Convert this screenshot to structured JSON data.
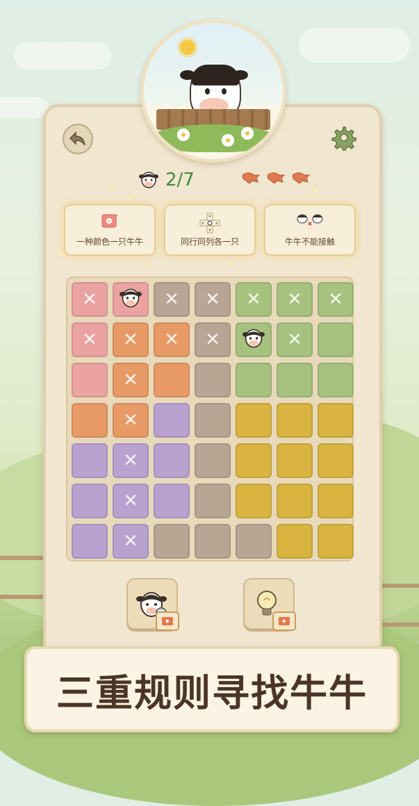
{
  "progress": {
    "found": 2,
    "total": 7,
    "text": "2/7"
  },
  "lives": 3,
  "rules": [
    {
      "label": "一种颜色一只牛牛",
      "icon": "flower-tile-icon"
    },
    {
      "label": "同行同列各一只",
      "icon": "row-column-icon"
    },
    {
      "label": "牛牛不能接触",
      "icon": "cows-no-touch-icon"
    }
  ],
  "board": {
    "colors": {
      "P": "#eaa3a0",
      "O": "#e89a66",
      "G": "#b8a594",
      "N": "#a6c27e",
      "V": "#b9a1d0",
      "Y": "#d9b440"
    },
    "rows": [
      [
        {
          "c": "P",
          "m": "x"
        },
        {
          "c": "P",
          "m": "cow"
        },
        {
          "c": "G",
          "m": "x"
        },
        {
          "c": "G",
          "m": "x"
        },
        {
          "c": "N",
          "m": "x"
        },
        {
          "c": "N",
          "m": "x"
        },
        {
          "c": "N",
          "m": "x"
        }
      ],
      [
        {
          "c": "P",
          "m": "x"
        },
        {
          "c": "O",
          "m": "x"
        },
        {
          "c": "O",
          "m": "x"
        },
        {
          "c": "G",
          "m": "x"
        },
        {
          "c": "N",
          "m": "cow"
        },
        {
          "c": "N",
          "m": "x"
        },
        {
          "c": "N",
          "m": ""
        }
      ],
      [
        {
          "c": "P",
          "m": ""
        },
        {
          "c": "O",
          "m": "x"
        },
        {
          "c": "O",
          "m": ""
        },
        {
          "c": "G",
          "m": ""
        },
        {
          "c": "N",
          "m": ""
        },
        {
          "c": "N",
          "m": ""
        },
        {
          "c": "N",
          "m": ""
        }
      ],
      [
        {
          "c": "O",
          "m": ""
        },
        {
          "c": "O",
          "m": "x"
        },
        {
          "c": "V",
          "m": ""
        },
        {
          "c": "G",
          "m": ""
        },
        {
          "c": "Y",
          "m": ""
        },
        {
          "c": "Y",
          "m": ""
        },
        {
          "c": "Y",
          "m": ""
        }
      ],
      [
        {
          "c": "V",
          "m": ""
        },
        {
          "c": "V",
          "m": "x"
        },
        {
          "c": "V",
          "m": ""
        },
        {
          "c": "G",
          "m": ""
        },
        {
          "c": "Y",
          "m": ""
        },
        {
          "c": "Y",
          "m": ""
        },
        {
          "c": "Y",
          "m": ""
        }
      ],
      [
        {
          "c": "V",
          "m": ""
        },
        {
          "c": "V",
          "m": "x"
        },
        {
          "c": "V",
          "m": ""
        },
        {
          "c": "G",
          "m": ""
        },
        {
          "c": "Y",
          "m": ""
        },
        {
          "c": "Y",
          "m": ""
        },
        {
          "c": "Y",
          "m": ""
        }
      ],
      [
        {
          "c": "V",
          "m": ""
        },
        {
          "c": "V",
          "m": "x"
        },
        {
          "c": "G",
          "m": ""
        },
        {
          "c": "G",
          "m": ""
        },
        {
          "c": "G",
          "m": ""
        },
        {
          "c": "Y",
          "m": ""
        },
        {
          "c": "Y",
          "m": ""
        }
      ]
    ]
  },
  "tools": {
    "cow_hint": {
      "icon": "cow-search-icon",
      "badge": "video-ad-icon"
    },
    "bulb_hint": {
      "icon": "lightbulb-icon",
      "badge": "video-ad-icon"
    }
  },
  "banner": {
    "text": "三重规则寻找牛牛"
  },
  "icons": {
    "back": "back-arrow-icon",
    "settings": "gear-icon",
    "heart": "heart-icon"
  }
}
